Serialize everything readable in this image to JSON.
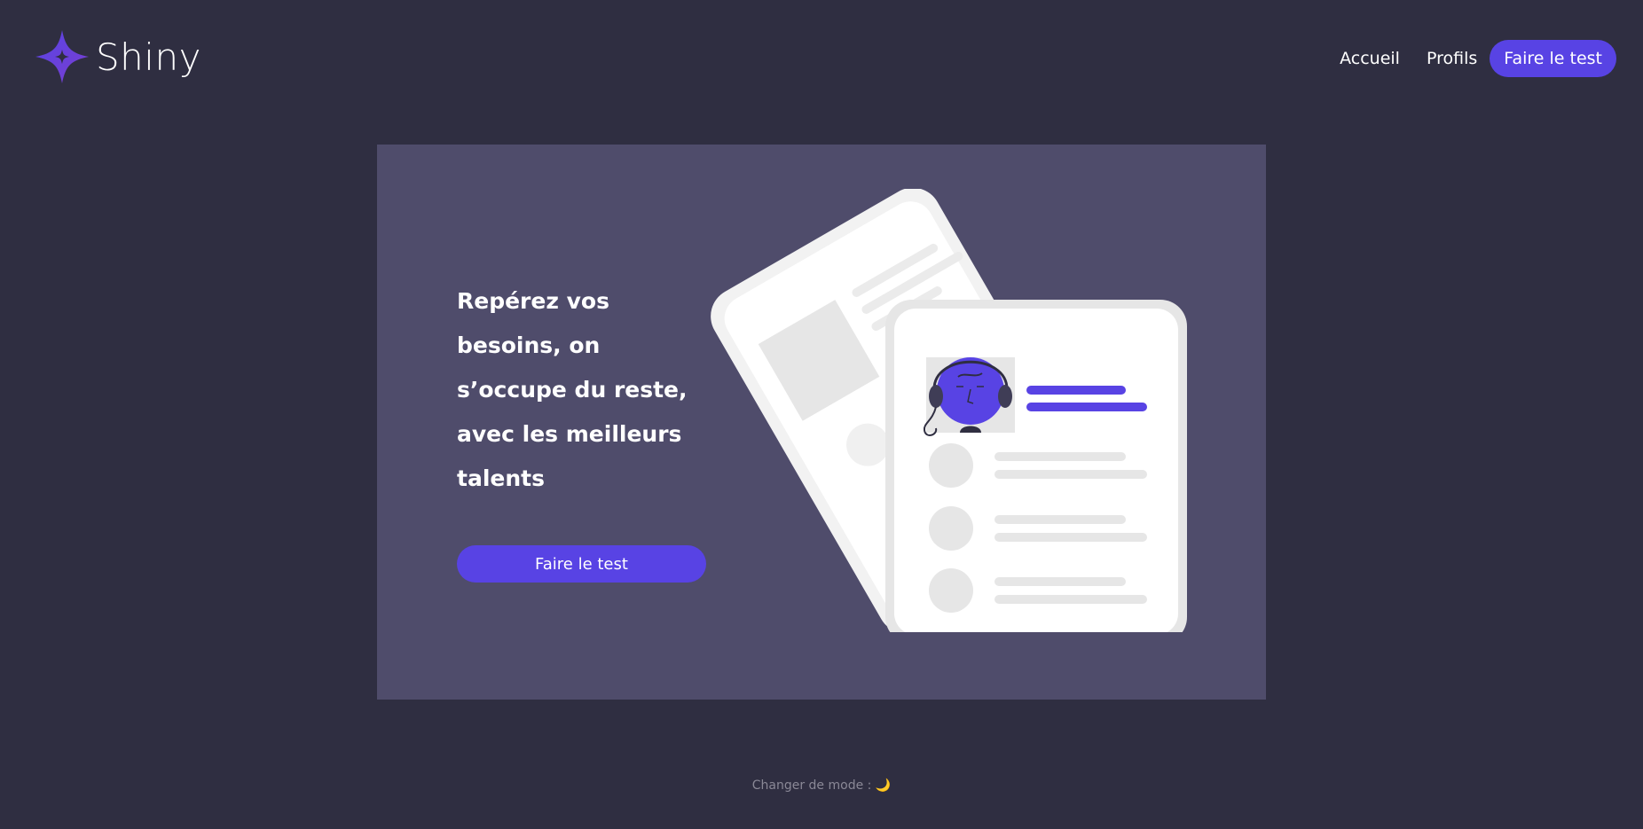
{
  "brand": {
    "name": "Shiny",
    "accent": "#5843e4",
    "background": "#2f2e41",
    "panel": "#4f4c6b"
  },
  "nav": {
    "items": [
      {
        "label": "Accueil"
      },
      {
        "label": "Profils"
      }
    ],
    "cta_label": "Faire le test"
  },
  "hero": {
    "title": "Repérez vos besoins, on s’occupe du reste, avec les meilleurs talents",
    "cta_label": "Faire le test",
    "illustration": "profile-cards-illustration"
  },
  "footer": {
    "mode_label": "Changer de mode : ",
    "mode_icon": "🌙"
  }
}
